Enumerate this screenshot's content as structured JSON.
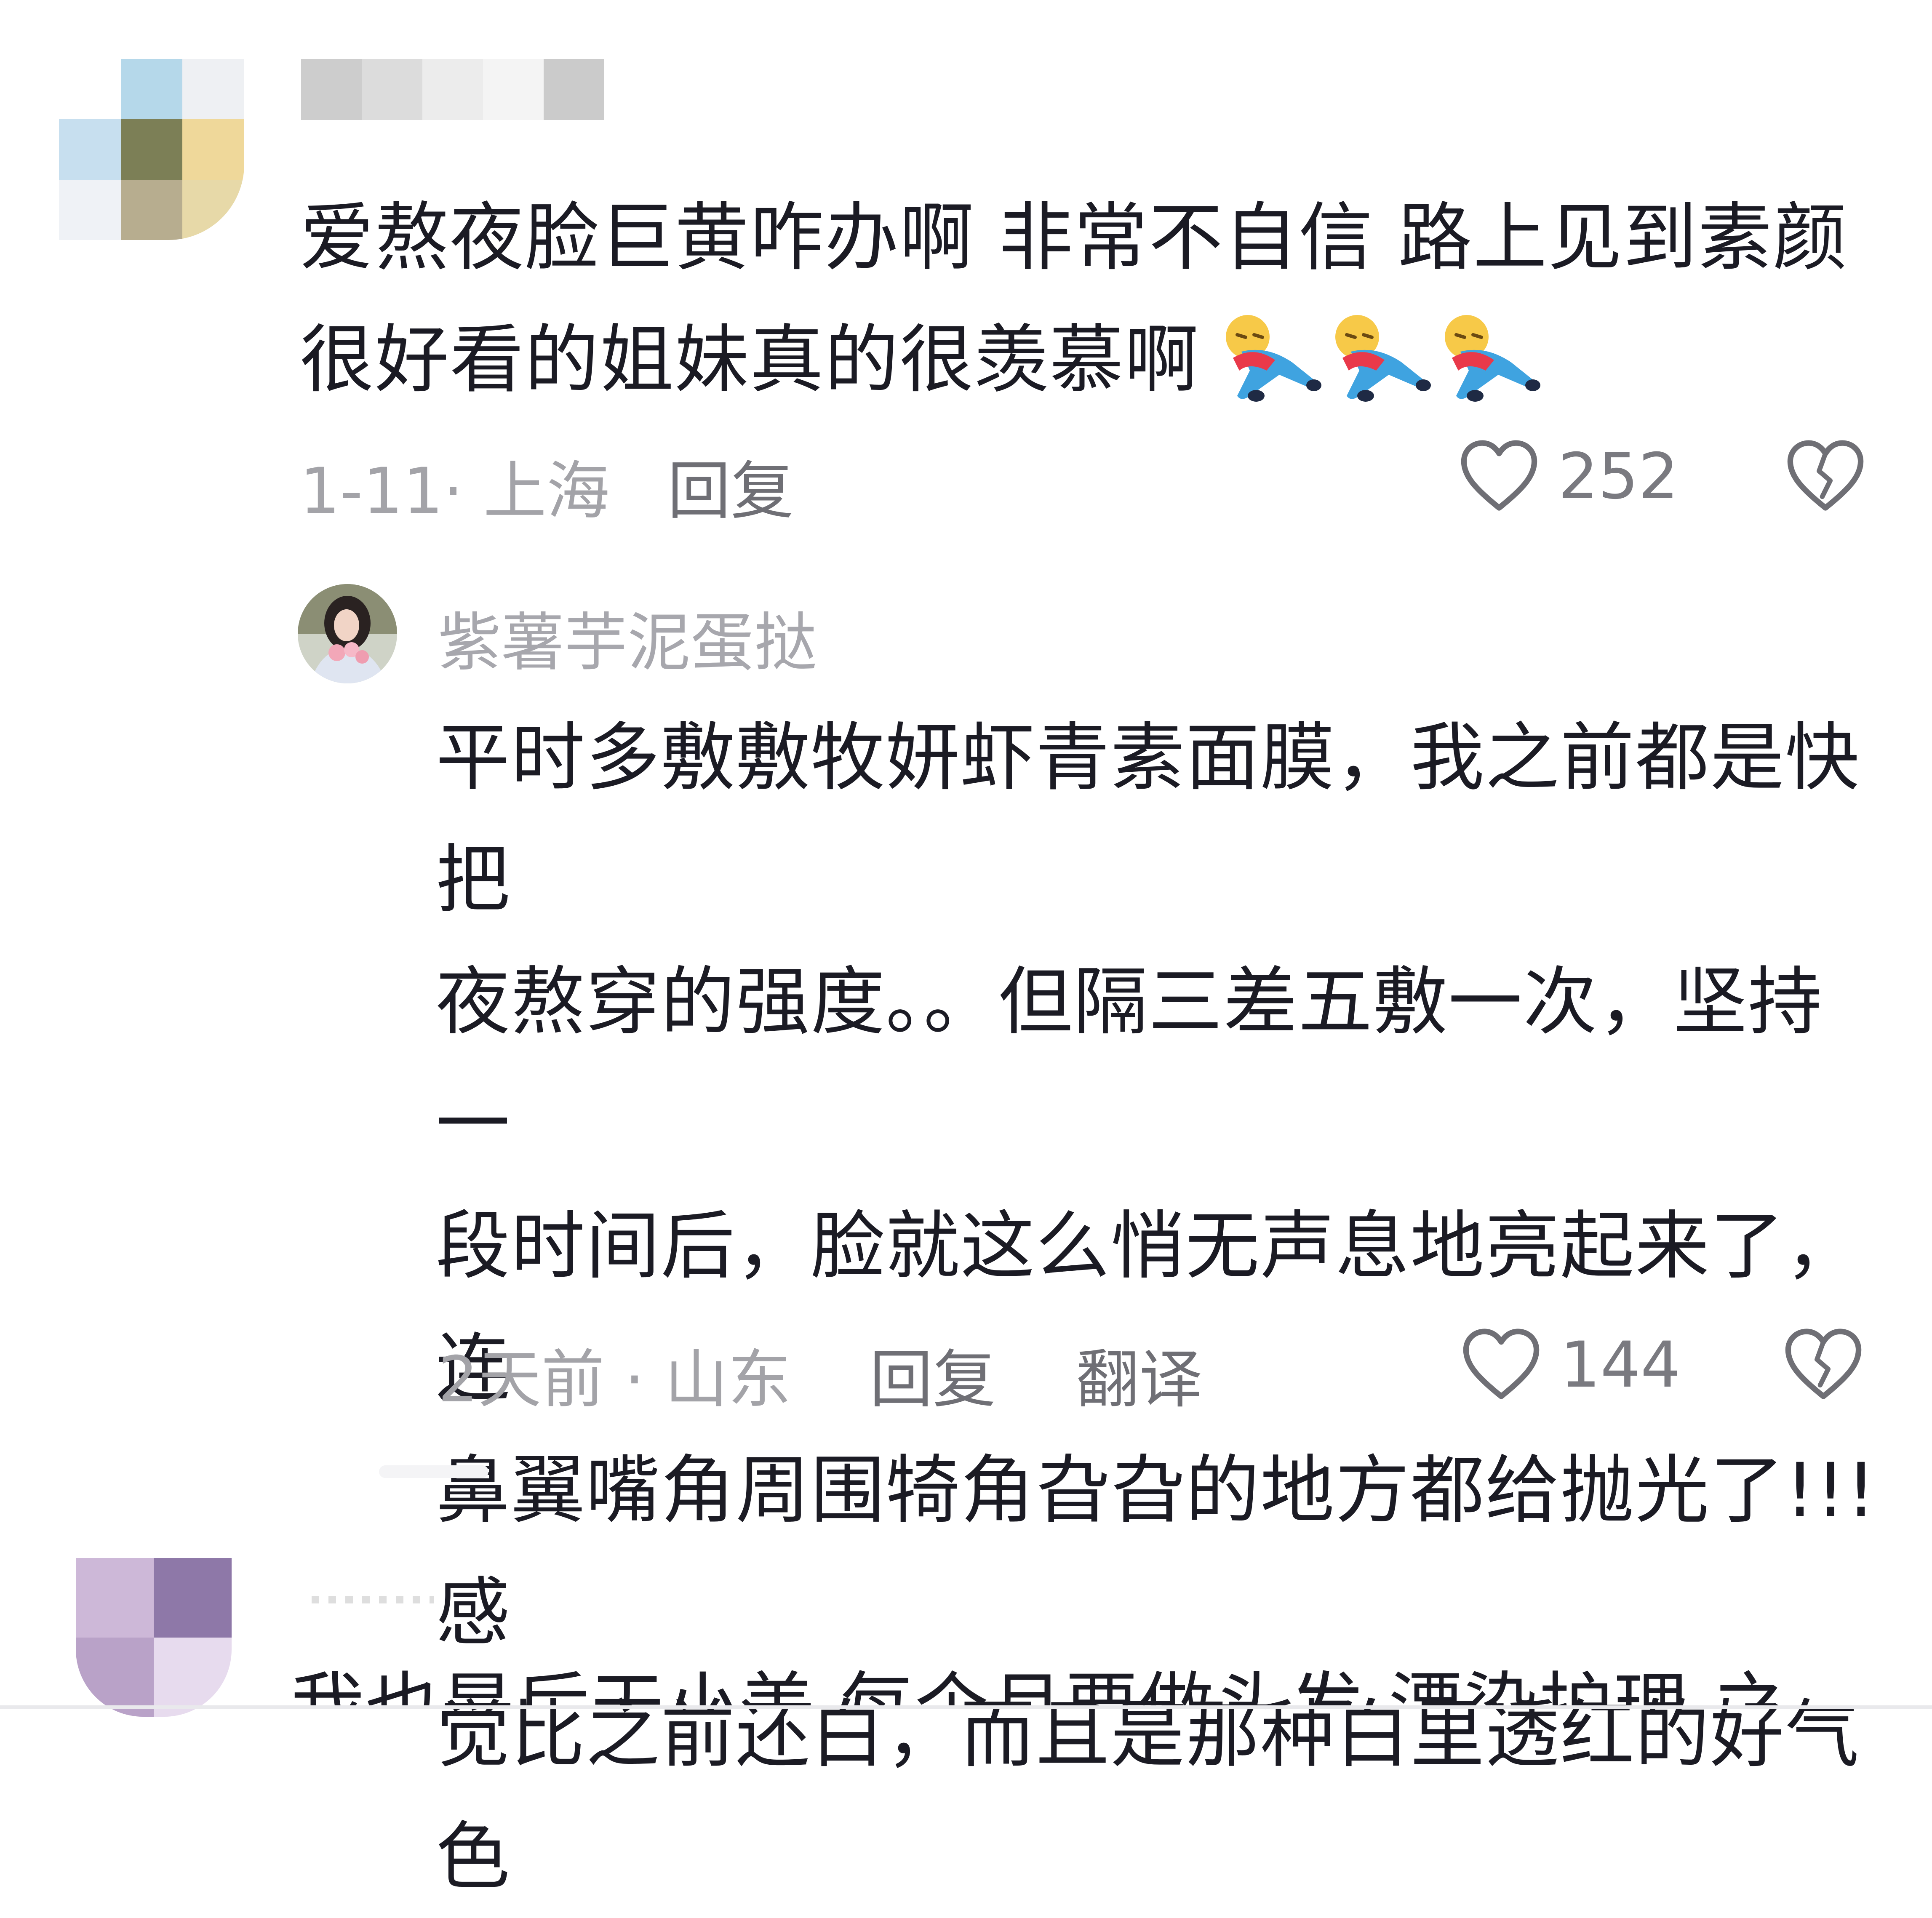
{
  "comments": [
    {
      "text_lines": [
        "爱熬夜脸巨黄咋办啊 非常不自信 路上见到素颜",
        "很好看的姐妹真的很羡慕啊"
      ],
      "emoji": [
        "crying-figure-emoji",
        "crying-figure-emoji",
        "crying-figure-emoji"
      ],
      "date_location": "1-11· 上海",
      "reply_label": "回复",
      "like_count": "252"
    }
  ],
  "reply": {
    "username": "紫薯芋泥蛋挞",
    "text_lines": [
      "平时多敷敷牧妍虾青素面膜，我之前都是快把",
      "夜熬穿的强度。。但隔三差五敷一次，坚持一",
      "段时间后，脸就这么悄无声息地亮起来了，连",
      "鼻翼嘴角周围犄角旮旮的地方都给抛光了!!!感",
      "觉比之前还白，而且是那种白里透红的好气色"
    ],
    "date_location": "2天前 · 山东",
    "reply_label": "回复",
    "translate_label": "翻译",
    "like_count": "144"
  },
  "next_comment": {
    "partial_text": "我也是后天小美 每个月要做头发 漂染护理 之"
  },
  "colors": {
    "text": "#1b1b24",
    "meta": "#a3a3a8",
    "action": "#6f6f75"
  },
  "icons": {
    "like": "heart-outline-icon",
    "dislike": "broken-heart-icon"
  }
}
